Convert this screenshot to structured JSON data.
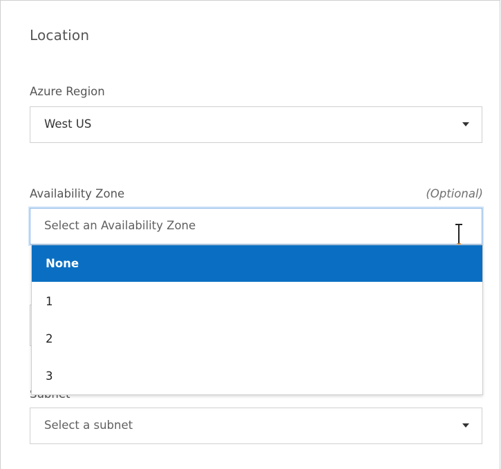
{
  "location": {
    "title": "Location"
  },
  "azure_region": {
    "label": "Azure Region",
    "value": "West US"
  },
  "availability_zone": {
    "label": "Availability Zone",
    "optional_label": "(Optional)",
    "placeholder": "Select an Availability Zone",
    "options": [
      {
        "label": "None",
        "selected": true
      },
      {
        "label": "1"
      },
      {
        "label": "2"
      },
      {
        "label": "3"
      }
    ]
  },
  "subnet": {
    "label": "Subnet",
    "placeholder": "Select a subnet"
  },
  "colors": {
    "selected_option": "#0a6fc2",
    "focus_border": "#8bb8e8"
  }
}
